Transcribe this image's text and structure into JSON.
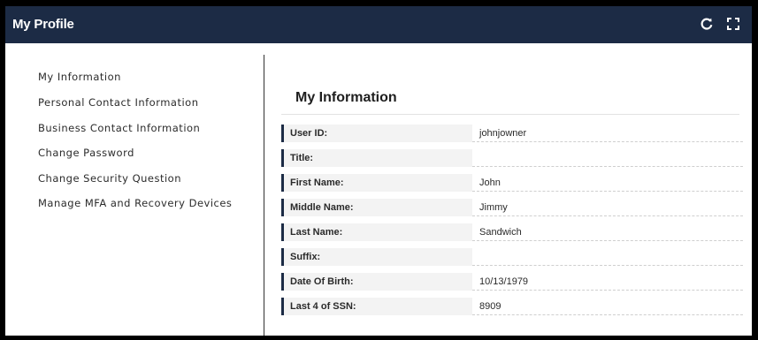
{
  "header": {
    "title": "My Profile",
    "refresh_icon": "refresh-icon",
    "expand_icon": "fullscreen-icon"
  },
  "sidebar": {
    "items": [
      {
        "label": "My Information"
      },
      {
        "label": "Personal Contact Information"
      },
      {
        "label": "Business Contact Information"
      },
      {
        "label": "Change Password"
      },
      {
        "label": "Change Security Question"
      },
      {
        "label": "Manage MFA and Recovery Devices"
      }
    ]
  },
  "main": {
    "section_title": "My Information",
    "fields": [
      {
        "label": "User ID:",
        "value": "johnjowner"
      },
      {
        "label": "Title:",
        "value": ""
      },
      {
        "label": "First Name:",
        "value": "John"
      },
      {
        "label": "Middle Name:",
        "value": "Jimmy"
      },
      {
        "label": "Last Name:",
        "value": "Sandwich"
      },
      {
        "label": "Suffix:",
        "value": ""
      },
      {
        "label": "Date Of Birth:",
        "value": "10/13/1979"
      },
      {
        "label": "Last 4 of SSN:",
        "value": "8909"
      }
    ]
  },
  "colors": {
    "header_bg": "#1c2b45",
    "label_accent": "#1c2b45"
  }
}
